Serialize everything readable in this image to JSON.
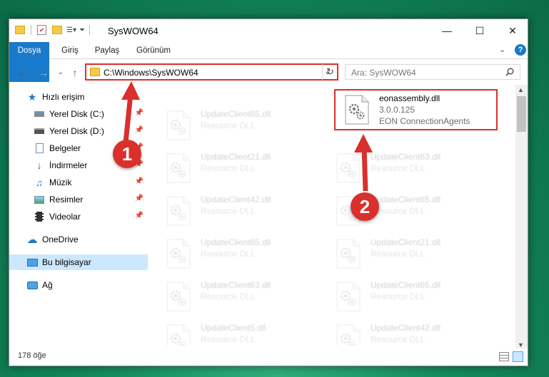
{
  "window": {
    "title": "SysWOW64",
    "minimize": "—",
    "maximize": "☐",
    "close": "✕"
  },
  "ribbon": {
    "tabs": [
      "Dosya",
      "Giriş",
      "Paylaş",
      "Görünüm"
    ],
    "expand": "⌄",
    "help": "?"
  },
  "address": {
    "path": "C:\\Windows\\SysWOW64",
    "dropdown": "⌄",
    "refresh": "↻"
  },
  "search": {
    "placeholder": "Ara: SysWOW64"
  },
  "nav_buttons": {
    "back": "←",
    "forward": "→",
    "recent": "⌄",
    "up": "↑"
  },
  "navpane": {
    "quick_access": "Hızlı erişim",
    "items": [
      "Yerel Disk (C:)",
      "Yerel Disk (D:)",
      "Belgeler",
      "İndirmeler",
      "Müzik",
      "Resimler",
      "Videolar"
    ],
    "onedrive": "OneDrive",
    "this_pc": "Bu bilgisayar",
    "network": "Ağ",
    "pin": "📌"
  },
  "files": {
    "left": [
      {
        "name": "UpdateClient65.dll",
        "type": "Resource DLL"
      },
      {
        "name": "UpdateClient21.dll",
        "type": "Resource DLL"
      },
      {
        "name": "UpdateClient42.dll",
        "type": "Resource DLL"
      },
      {
        "name": "UpdateClient65.dll",
        "type": "Resource DLL"
      },
      {
        "name": "UpdateClient63.dll",
        "type": "Resource DLL"
      },
      {
        "name": "UpdateClient5.dll",
        "type": "Resource DLL"
      }
    ],
    "right": [
      {
        "name": "UpdateClient63.dll",
        "type": "Resource DLL"
      },
      {
        "name": "UpdateClient65.dll",
        "type": "Resource DLL"
      },
      {
        "name": "UpdateClient21.dll",
        "type": "Resource DLL"
      },
      {
        "name": "UpdateClient65.dll",
        "type": "Resource DLL"
      },
      {
        "name": "UpdateClient42.dll",
        "type": "Resource DLL"
      }
    ],
    "highlighted": {
      "name": "eonassembly.dll",
      "version": "3.0.0.125",
      "company": "EON ConnectionAgents"
    }
  },
  "status": {
    "count": "178 öğe"
  },
  "annotations": {
    "step1": "1",
    "step2": "2",
    "color": "#d9302c"
  },
  "colors": {
    "file_tab": "#1979ca",
    "selection": "#cce8ff",
    "folder": "#f7c948"
  }
}
